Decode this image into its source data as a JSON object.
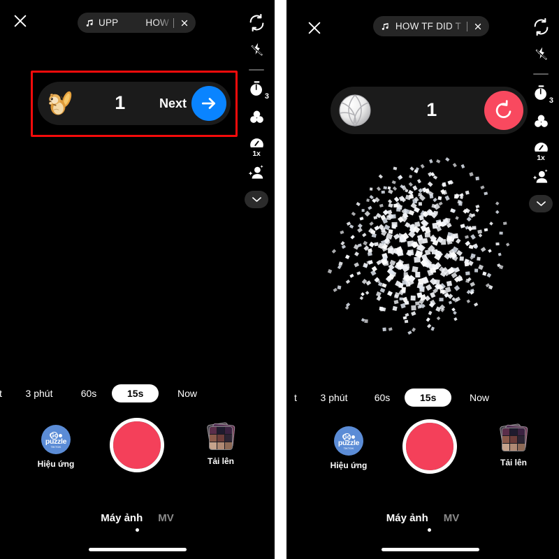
{
  "app": {
    "accent_blue": "#0a84ff",
    "accent_red": "#f9495f",
    "shutter_red": "#f4405a",
    "panel_bg": "#000000",
    "pill_bg": "#1b1b1b",
    "annotation_color": "#f40b0b"
  },
  "left_panel": {
    "close_label": "close-icon",
    "music": {
      "icon": "music-note-icon",
      "text_primary": "UPP",
      "text_secondary": "HOW",
      "close_label": "x"
    },
    "rail": [
      {
        "name": "flip-camera",
        "icon": "flip-camera-icon",
        "badge": ""
      },
      {
        "name": "flash",
        "icon": "flash-off-icon",
        "badge": ""
      },
      {
        "name": "timer",
        "icon": "timer-icon",
        "badge": "3"
      },
      {
        "name": "filters",
        "icon": "filters-icon",
        "badge": ""
      },
      {
        "name": "speed",
        "icon": "speed-icon",
        "badge": "1x"
      },
      {
        "name": "beauty",
        "icon": "beauty-person-sparkle-icon",
        "badge": ""
      },
      {
        "name": "more",
        "icon": "chevron-down-icon",
        "badge": ""
      }
    ],
    "action_pill": {
      "emoji": "chipmunk-emoji",
      "count": "1",
      "cta_label": "Next",
      "cta_icon": "arrow-right-icon",
      "cta_color": "#0a84ff"
    },
    "durations": [
      {
        "label": "t",
        "active": false,
        "clipped": true
      },
      {
        "label": "3 phút",
        "active": false
      },
      {
        "label": "60s",
        "active": false
      },
      {
        "label": "15s",
        "active": true
      },
      {
        "label": "Now",
        "active": false
      }
    ],
    "effects": {
      "label": "Hiệu ứng",
      "icon_word": "puzzle",
      "icon_go": "Go",
      "icon_sub": "TIKTOK"
    },
    "upload": {
      "label": "Tải lên",
      "icon": "photo-stack-icon"
    },
    "shutter": {
      "name": "record-button"
    },
    "tabs": [
      {
        "label": "Máy ảnh",
        "active": true
      },
      {
        "label": "MV",
        "active": false
      }
    ]
  },
  "right_panel": {
    "close_label": "close-icon",
    "music": {
      "icon": "music-note-icon",
      "text_primary": "HOW TF DID T",
      "text_secondary": "",
      "close_label": "x"
    },
    "rail": [
      {
        "name": "flip-camera",
        "icon": "flip-camera-icon",
        "badge": ""
      },
      {
        "name": "flash",
        "icon": "flash-off-icon",
        "badge": ""
      },
      {
        "name": "timer",
        "icon": "timer-icon",
        "badge": "3"
      },
      {
        "name": "filters",
        "icon": "filters-icon",
        "badge": ""
      },
      {
        "name": "speed",
        "icon": "speed-icon",
        "badge": "1x"
      },
      {
        "name": "beauty",
        "icon": "beauty-person-sparkle-icon",
        "badge": ""
      },
      {
        "name": "more",
        "icon": "chevron-down-icon",
        "badge": ""
      }
    ],
    "action_pill": {
      "emoji": "volleyball-emoji",
      "count": "1",
      "cta_label": "",
      "cta_icon": "reset-rotate-icon",
      "cta_color": "#f9495f"
    },
    "durations": [
      {
        "label": "t",
        "active": false,
        "clipped": true
      },
      {
        "label": "3 phút",
        "active": false
      },
      {
        "label": "60s",
        "active": false
      },
      {
        "label": "15s",
        "active": true
      },
      {
        "label": "Now",
        "active": false
      }
    ],
    "effects": {
      "label": "Hiệu ứng",
      "icon_word": "puzzle",
      "icon_go": "Go",
      "icon_sub": "TIKTOK"
    },
    "upload": {
      "label": "Tải lên",
      "icon": "photo-stack-icon"
    },
    "shutter": {
      "name": "record-button"
    },
    "tabs": [
      {
        "label": "Máy ảnh",
        "active": true
      },
      {
        "label": "MV",
        "active": false
      }
    ]
  }
}
